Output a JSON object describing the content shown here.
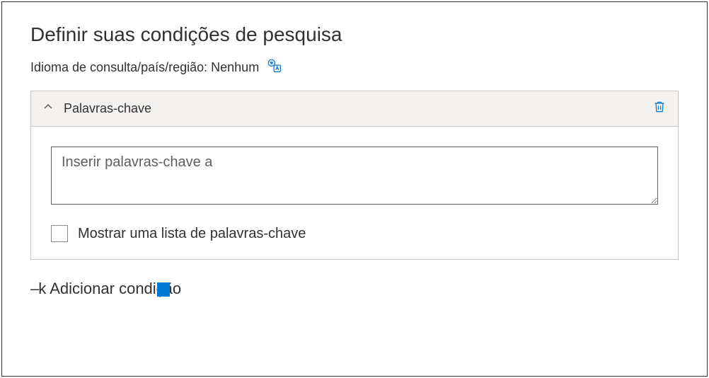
{
  "title": "Definir suas condições de pesquisa",
  "language": {
    "label": "Idioma de consulta/país/região: Nenhum"
  },
  "keywords": {
    "header": "Palavras-chave",
    "placeholder": "Inserir palavras-chave a",
    "checkboxLabel": "Mostrar uma lista de palavras-chave"
  },
  "addCondition": {
    "prefix": "–k",
    "label": "Adicionar condição"
  }
}
